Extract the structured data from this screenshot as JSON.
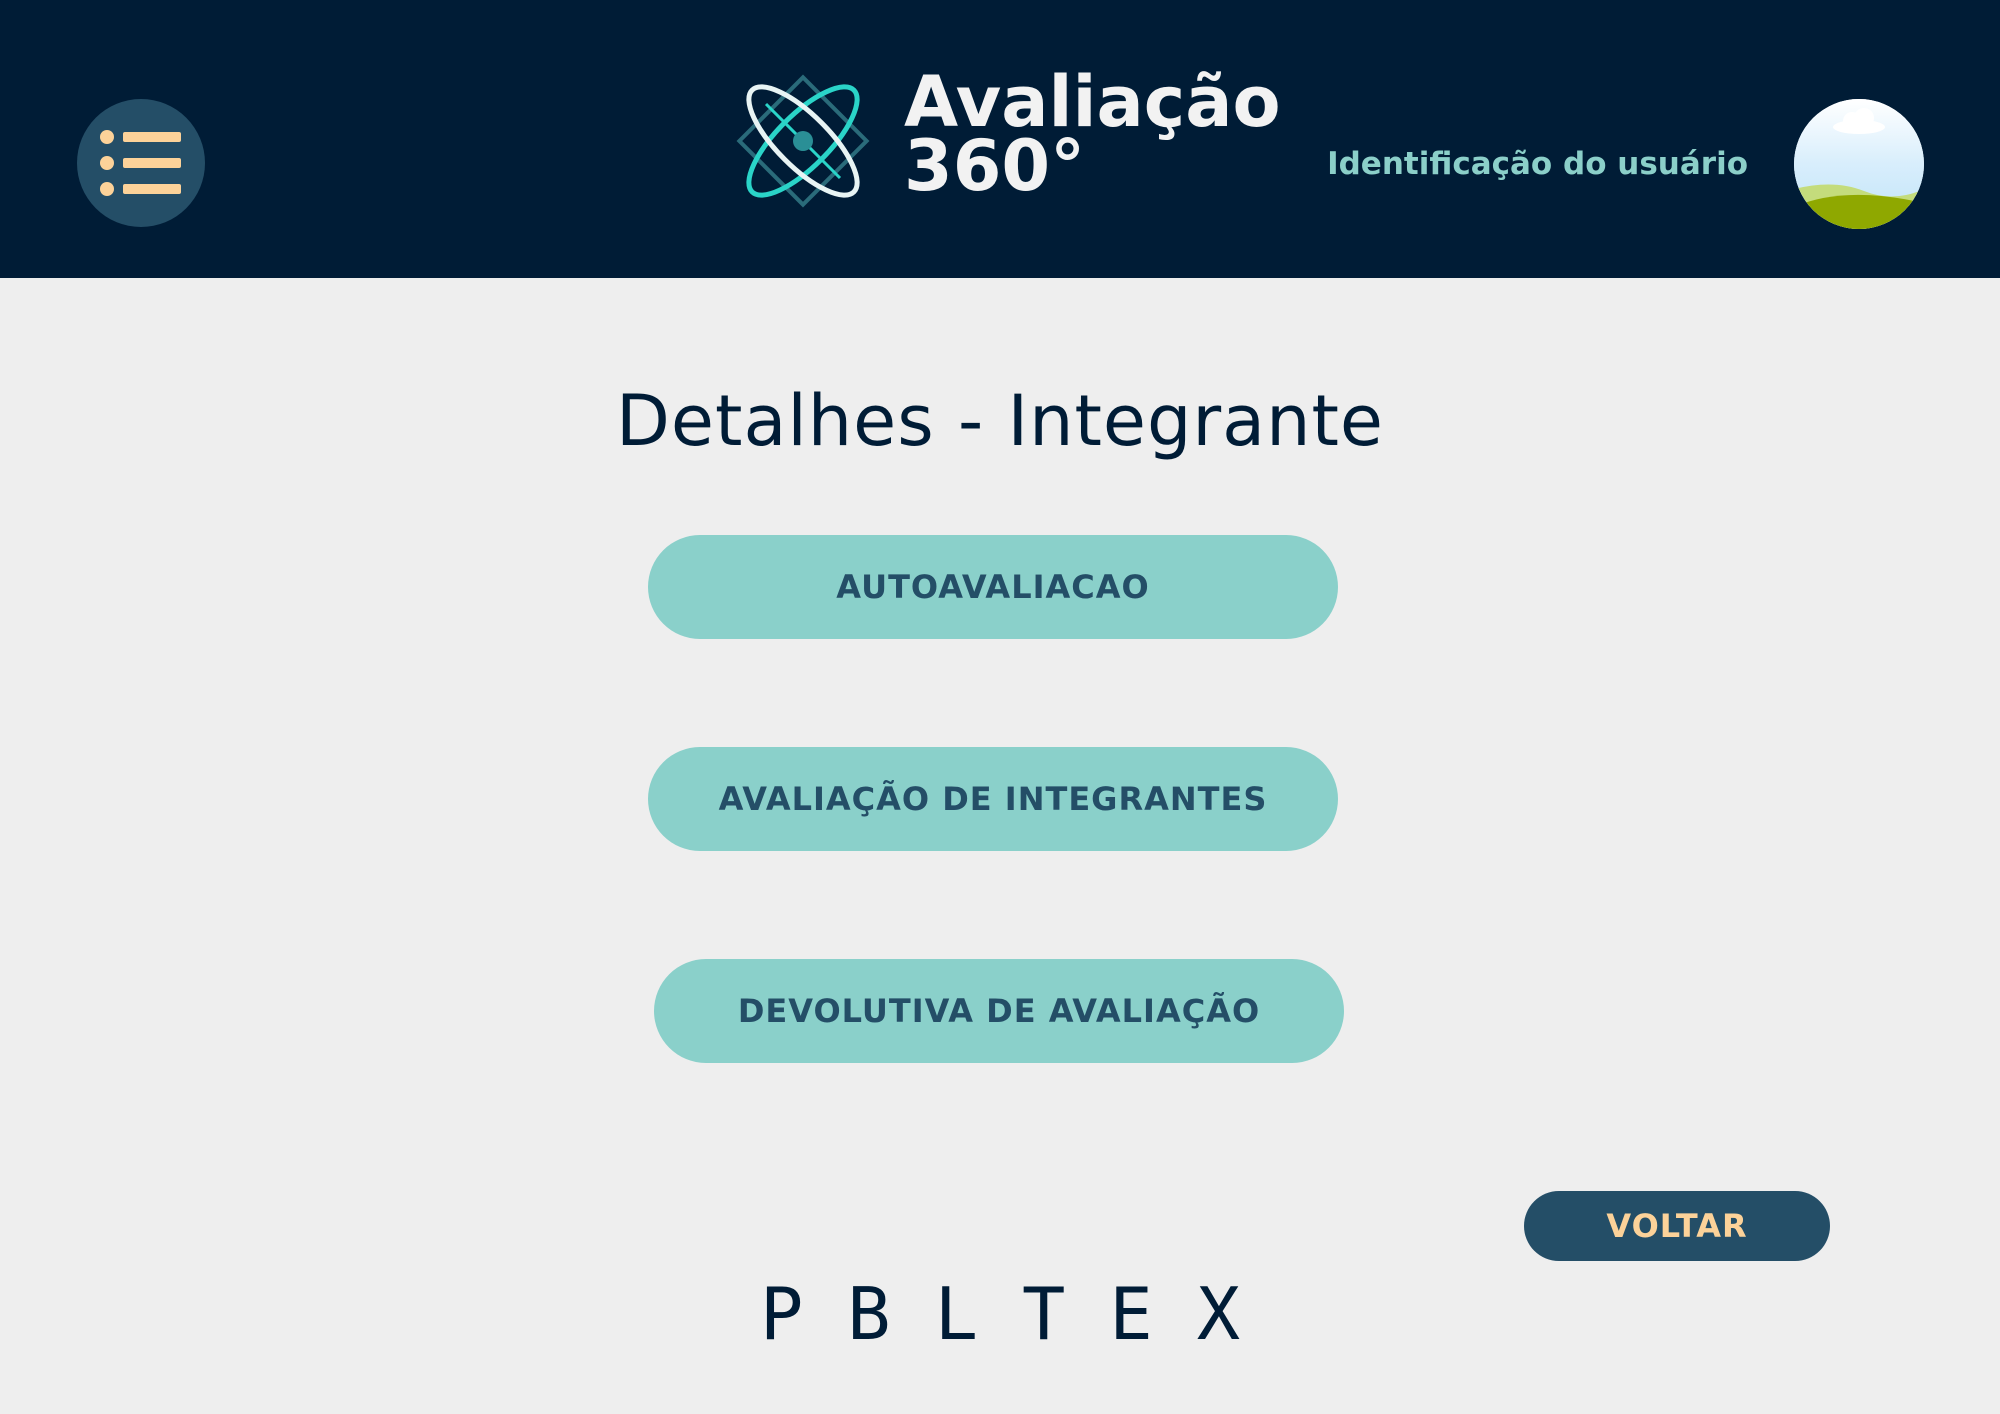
{
  "header": {
    "app_name_line1": "Avaliação",
    "app_name_line2": "360°",
    "user_label": "Identificação do usuário",
    "menu_icon": "list-menu-icon",
    "avatar_icon": "landscape-avatar-icon"
  },
  "main": {
    "title": "Detalhes - Integrante",
    "buttons": [
      {
        "label": "AUTOAVALIACAO"
      },
      {
        "label": "AVALIAÇÃO DE INTEGRANTES"
      },
      {
        "label": "DEVOLUTIVA DE AVALIAÇÃO"
      }
    ],
    "back_label": "VOLTAR"
  },
  "footer": {
    "brand": "PBLTEX"
  },
  "colors": {
    "header_bg": "#001c36",
    "page_bg": "#eeeeee",
    "button_bg": "#8ad0ca",
    "button_text": "#244e67",
    "back_bg": "#244e67",
    "back_text": "#fcd299",
    "accent_teal": "#2ad4c8"
  }
}
